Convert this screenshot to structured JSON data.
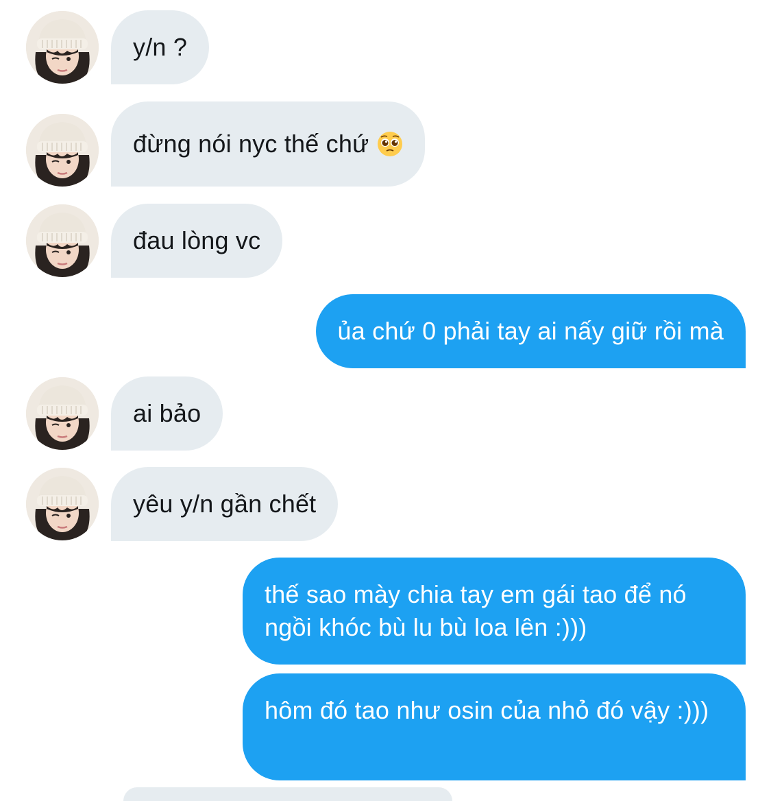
{
  "messages": [
    {
      "side": "in",
      "text": "y/n ?"
    },
    {
      "side": "in",
      "text": "đừng nói nyc thế chứ",
      "emoji": "pleading-face-emoji"
    },
    {
      "side": "in",
      "text": "đau lòng vc"
    },
    {
      "side": "out",
      "text": "ủa chứ 0 phải tay ai nấy giữ rồi mà"
    },
    {
      "side": "in",
      "text": "ai bảo"
    },
    {
      "side": "in",
      "text": "yêu y/n gần chết"
    },
    {
      "side": "out",
      "text": "thế sao mày chia tay em gái tao để nó ngồi khóc bù lu bù loa lên :)))"
    },
    {
      "side": "out",
      "text": "hôm đó tao như osin của nhỏ đó vậy :)))"
    }
  ],
  "colors": {
    "incoming_bubble": "#e6ecf0",
    "outgoing_bubble": "#1da1f2",
    "incoming_text": "#14171a",
    "outgoing_text": "#ffffff"
  }
}
